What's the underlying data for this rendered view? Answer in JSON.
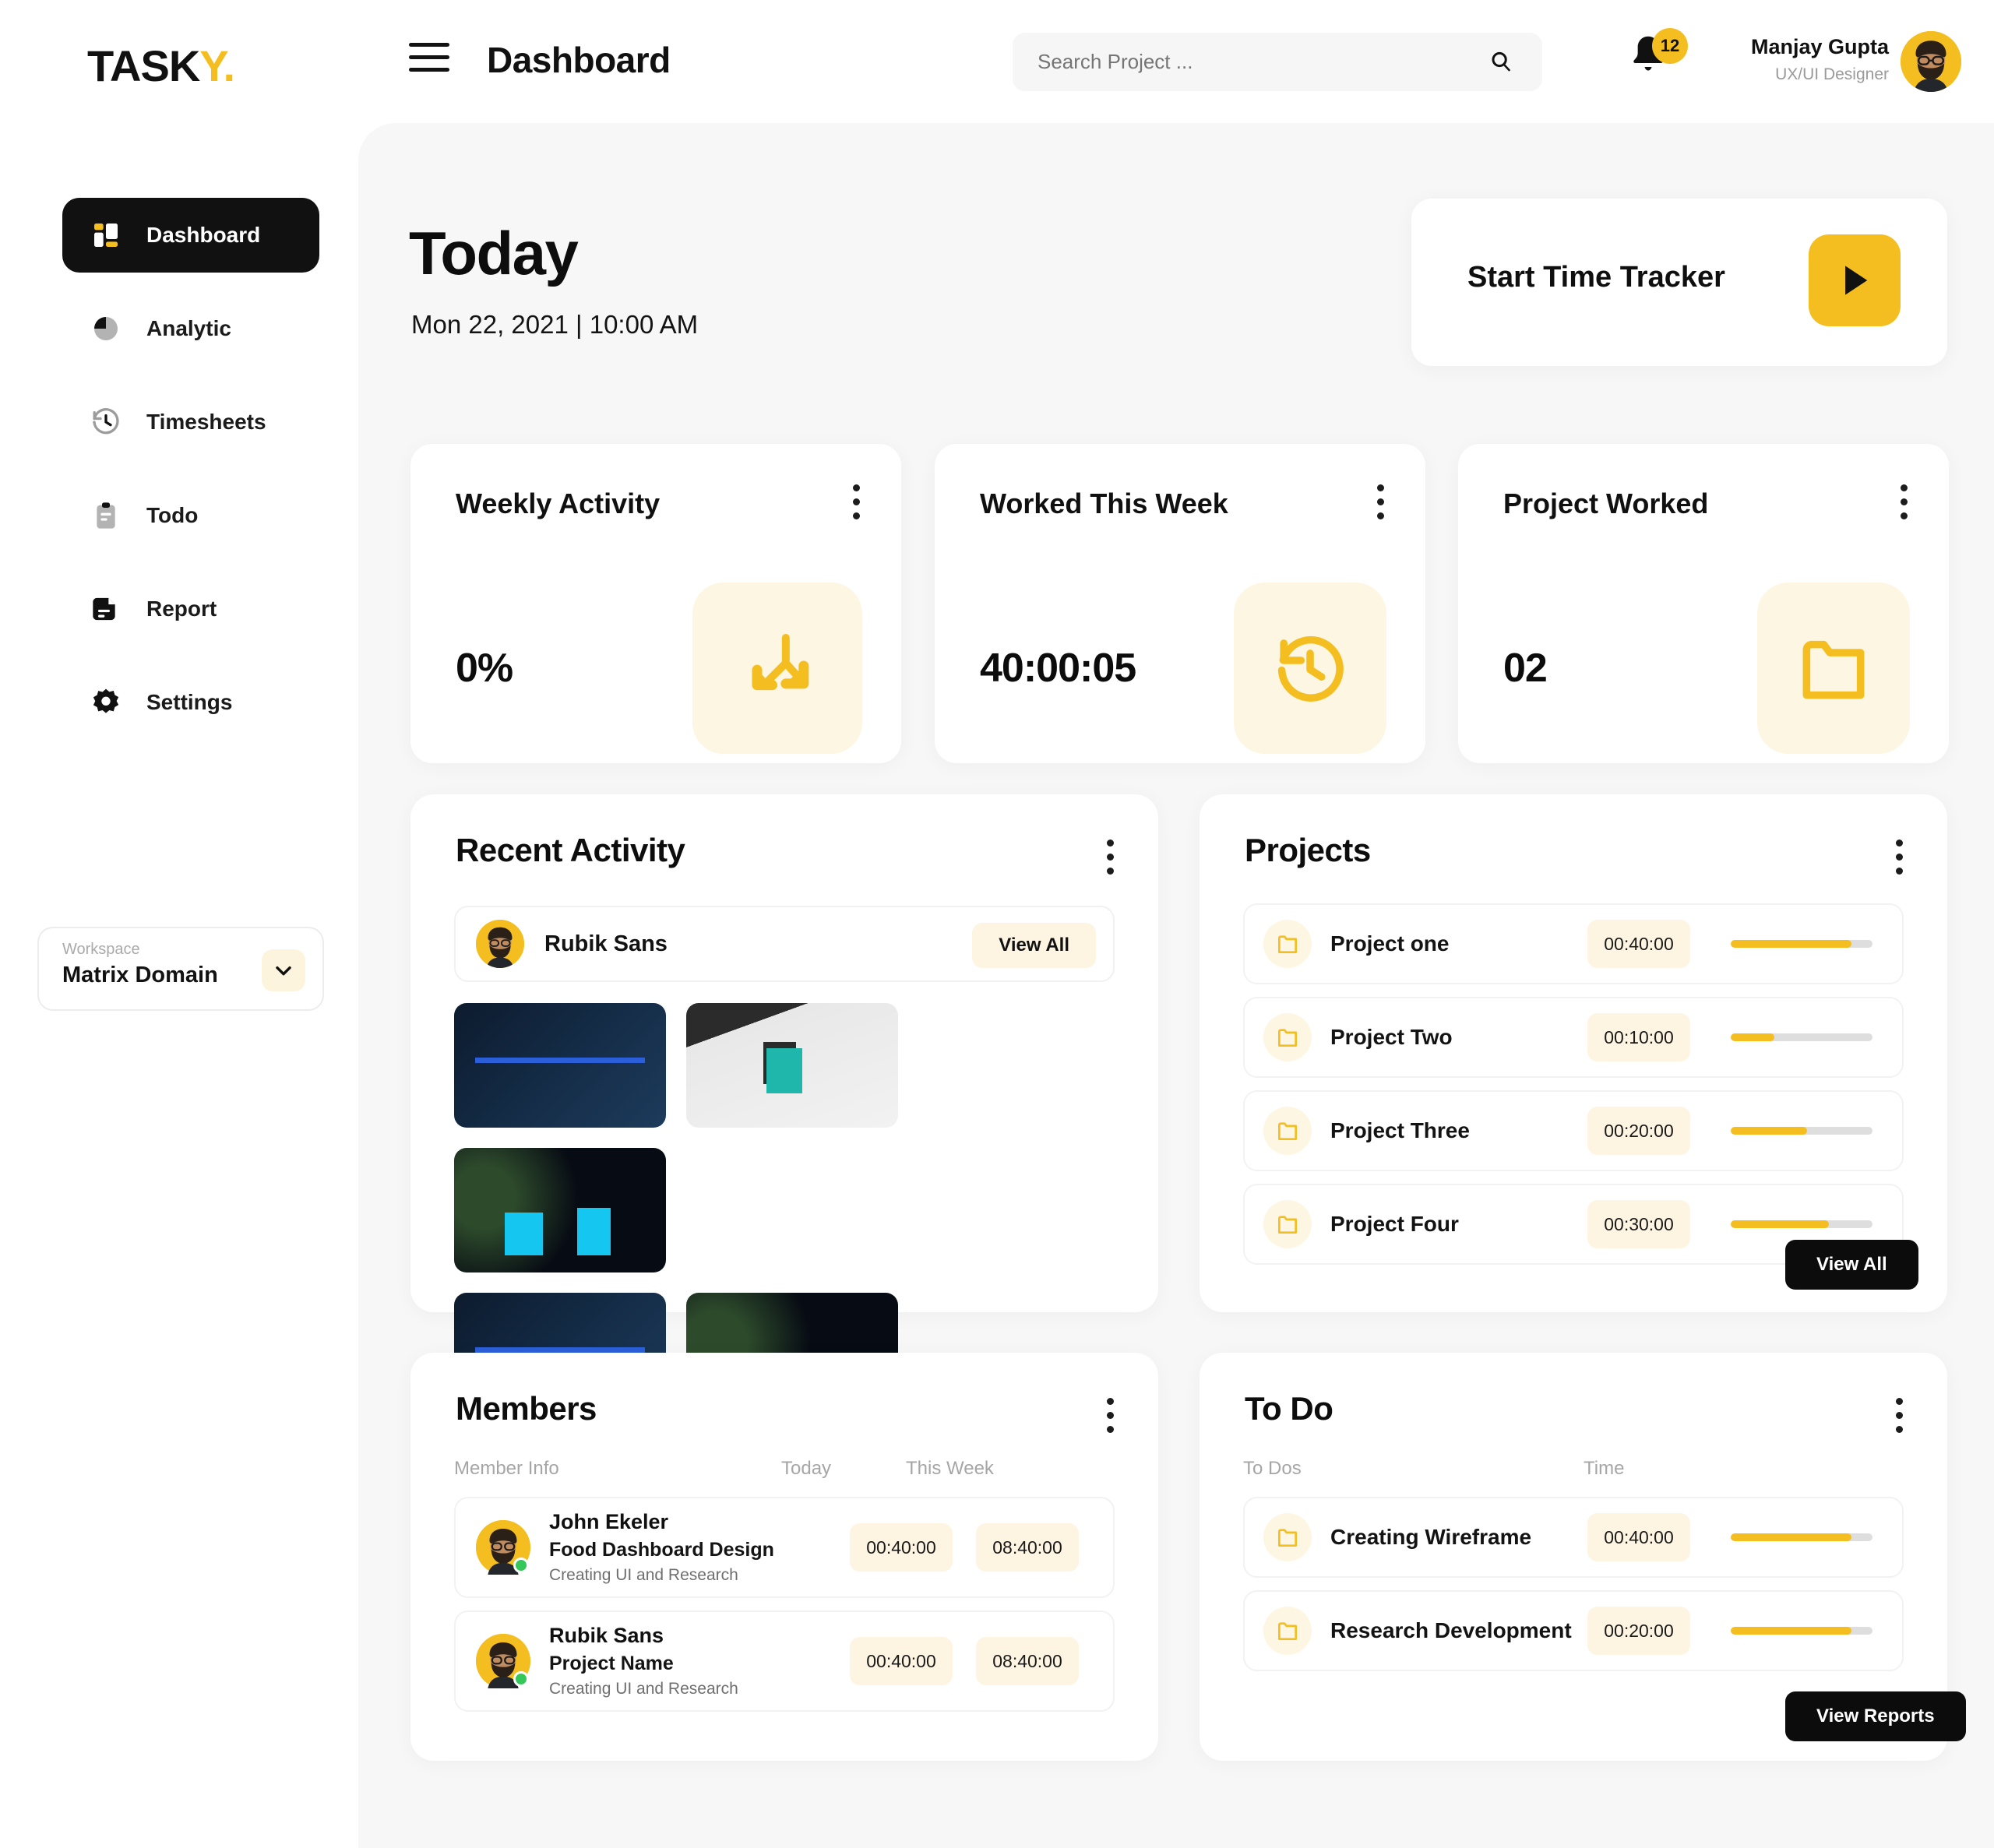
{
  "brand": {
    "name_dark": "TASK",
    "name_accent": "Y.",
    "accent_color": "#F5BE20"
  },
  "header": {
    "page_title": "Dashboard",
    "search": {
      "placeholder": "Search Project ...",
      "value": ""
    },
    "notifications_count": "12",
    "user": {
      "name": "Manjay Gupta",
      "role": "UX/UI Designer"
    }
  },
  "sidebar": {
    "items": [
      {
        "label": "Dashboard",
        "icon": "grid-icon",
        "active": true
      },
      {
        "label": "Analytic",
        "icon": "pie-chart-icon",
        "active": false
      },
      {
        "label": "Timesheets",
        "icon": "clock-history-icon",
        "active": false
      },
      {
        "label": "Todo",
        "icon": "clipboard-icon",
        "active": false
      },
      {
        "label": "Report",
        "icon": "document-icon",
        "active": false
      },
      {
        "label": "Settings",
        "icon": "gear-icon",
        "active": false
      }
    ],
    "workspace": {
      "label": "Workspace",
      "value": "Matrix Domain",
      "chevron_icon": "chevron-down-icon"
    }
  },
  "today": {
    "heading": "Today",
    "datetime": "Mon 22, 2021 | 10:00 AM"
  },
  "tracker": {
    "label": "Start Time Tracker",
    "icon": "play-icon"
  },
  "stats": [
    {
      "title": "Weekly Activity",
      "value": "0%",
      "icon": "split-arrows-down-icon"
    },
    {
      "title": "Worked This Week",
      "value": "40:00:05",
      "icon": "clock-history-icon"
    },
    {
      "title": "Project Worked",
      "value": "02",
      "icon": "folder-icon"
    }
  ],
  "recent_activity": {
    "title": "Recent Activity",
    "user_name": "Rubik Sans",
    "view_all_label": "View All",
    "thumbnails": [
      {
        "kind": "code-editor-screenshot"
      },
      {
        "kind": "design-mockup-screenshot"
      },
      {
        "kind": "analytics-dashboard-screenshot"
      },
      {
        "kind": "code-editor-screenshot"
      },
      {
        "kind": "analytics-dashboard-screenshot"
      }
    ]
  },
  "projects": {
    "title": "Projects",
    "view_all_label": "View All",
    "rows": [
      {
        "name": "Project one",
        "time": "00:40:00",
        "progress": 85
      },
      {
        "name": "Project Two",
        "time": "00:10:00",
        "progress": 31
      },
      {
        "name": "Project Three",
        "time": "00:20:00",
        "progress": 54
      },
      {
        "name": "Project Four",
        "time": "00:30:00",
        "progress": 69
      }
    ]
  },
  "members": {
    "title": "Members",
    "columns": {
      "info": "Member Info",
      "today": "Today",
      "week": "This Week"
    },
    "rows": [
      {
        "name": "John Ekeler",
        "project": "Food Dashboard Design",
        "desc": "Creating UI and Research",
        "today": "00:40:00",
        "week": "08:40:00",
        "online": true
      },
      {
        "name": "Rubik Sans",
        "project": "Project Name",
        "desc": "Creating UI and Research",
        "today": "00:40:00",
        "week": "08:40:00",
        "online": true
      }
    ]
  },
  "todo": {
    "title": "To Do",
    "columns": {
      "todos": "To Dos",
      "time": "Time"
    },
    "view_reports_label": "View Reports",
    "rows": [
      {
        "name": "Creating Wireframe",
        "time": "00:40:00",
        "progress": 85
      },
      {
        "name": "Research Development",
        "time": "00:20:00",
        "progress": 85
      }
    ]
  }
}
